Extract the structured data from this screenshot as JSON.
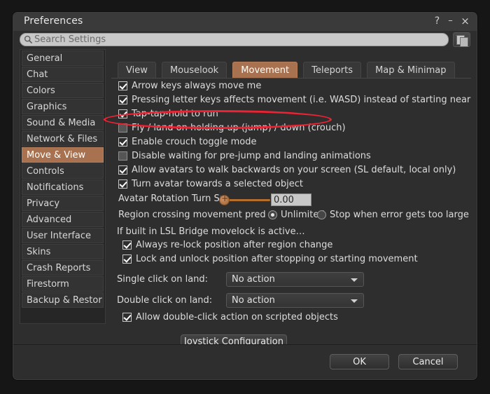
{
  "window": {
    "title": "Preferences",
    "help_icon": "question-mark-icon",
    "minimize_icon": "minimize-icon",
    "close_icon": "close-icon",
    "help_label": "?",
    "minimize_label": "–",
    "close_label": "×"
  },
  "search": {
    "placeholder": "Search Settings",
    "value": "",
    "icon": "magnifier-icon",
    "copy_button_icon": "copy-pages-icon"
  },
  "sidebar": {
    "items": [
      {
        "label": "General",
        "selected": false
      },
      {
        "label": "Chat",
        "selected": false
      },
      {
        "label": "Colors",
        "selected": false
      },
      {
        "label": "Graphics",
        "selected": false
      },
      {
        "label": "Sound & Media",
        "selected": false
      },
      {
        "label": "Network & Files",
        "selected": false
      },
      {
        "label": "Move & View",
        "selected": true
      },
      {
        "label": "Controls",
        "selected": false
      },
      {
        "label": "Notifications",
        "selected": false
      },
      {
        "label": "Privacy",
        "selected": false
      },
      {
        "label": "Advanced",
        "selected": false
      },
      {
        "label": "User Interface",
        "selected": false
      },
      {
        "label": "Skins",
        "selected": false
      },
      {
        "label": "Crash Reports",
        "selected": false
      },
      {
        "label": "Firestorm",
        "selected": false
      },
      {
        "label": "Backup & Restor",
        "selected": false
      }
    ]
  },
  "tabs": [
    {
      "label": "View",
      "active": false
    },
    {
      "label": "Mouselook",
      "active": false
    },
    {
      "label": "Movement",
      "active": true
    },
    {
      "label": "Teleports",
      "active": false
    },
    {
      "label": "Map & Minimap",
      "active": false
    }
  ],
  "movement": {
    "checkboxes": [
      {
        "label": "Arrow keys always move me",
        "checked": true
      },
      {
        "label": "Pressing letter keys affects movement (i.e. WASD) instead of starting nearby c",
        "checked": true
      },
      {
        "label": "Tap-tap-hold to run",
        "checked": true
      },
      {
        "label": "Fly / land on holding up (jump) / down (crouch)",
        "checked": false
      },
      {
        "label": "Enable crouch toggle mode",
        "checked": true
      },
      {
        "label": "Disable waiting for pre-jump and landing animations",
        "checked": false
      },
      {
        "label": "Allow avatars to walk backwards on your screen (SL default, local only)",
        "checked": true
      },
      {
        "label": "Turn avatar towards a selected object",
        "checked": true
      }
    ],
    "turn_speed": {
      "label": "Avatar Rotation Turn Sp",
      "value": "0.00",
      "slider_position_pct": 0
    },
    "region_crossing": {
      "label": "Region crossing movement pred",
      "options": [
        {
          "label": "Unlimited",
          "selected": true
        },
        {
          "label": "Stop when error gets too large",
          "selected": false
        }
      ]
    },
    "movelock": {
      "heading": "If built in LSL Bridge movelock is active…",
      "checkboxes": [
        {
          "label": "Always re-lock position after region change",
          "checked": true
        },
        {
          "label": "Lock and unlock position after stopping or starting movement",
          "checked": true
        }
      ]
    },
    "single_click": {
      "label": "Single click on land:",
      "value": "No action"
    },
    "double_click": {
      "label": "Double click on land:",
      "value": "No action"
    },
    "scripted_objects": {
      "label": "Allow double-click action on scripted objects",
      "checked": true
    },
    "joystick_button": "Joystick Configuration"
  },
  "footer": {
    "ok_label": "OK",
    "cancel_label": "Cancel"
  },
  "annotation": {
    "shape": "ellipse",
    "color": "#ef2233",
    "target": "Fly / land on holding up (jump) / down (crouch)"
  }
}
